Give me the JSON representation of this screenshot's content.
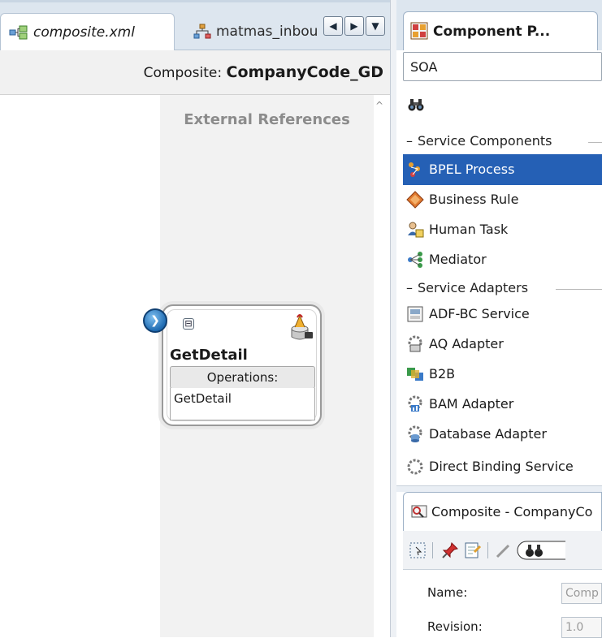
{
  "editor": {
    "tabs": [
      {
        "label": "composite.xml",
        "active": true,
        "icon": "composite-diagram-icon"
      },
      {
        "label": "matmas_inbou",
        "active": false,
        "icon": "mediator-flow-icon"
      }
    ],
    "nav_buttons": [
      "scroll-left-icon",
      "scroll-right-icon",
      "tab-list-dropdown-icon"
    ],
    "composite_label": "Composite:",
    "composite_name": "CompanyCode_GD",
    "swimlane_title": "External References",
    "component": {
      "title": "GetDetail",
      "operations_header": "Operations:",
      "operations": [
        "GetDetail"
      ],
      "collapse_symbol": "⊟",
      "service_icon": "web-service-icon",
      "pin_icon": "interface-pin-icon"
    }
  },
  "palette": {
    "tab_label": "Component P...",
    "category": "SOA",
    "search_icon": "binoculars-icon",
    "sections": [
      {
        "title": "Service Components",
        "items": [
          {
            "label": "BPEL Process",
            "icon": "bpel-process-icon",
            "selected": true
          },
          {
            "label": "Business Rule",
            "icon": "business-rule-icon",
            "selected": false
          },
          {
            "label": "Human Task",
            "icon": "human-task-icon",
            "selected": false
          },
          {
            "label": "Mediator",
            "icon": "mediator-icon",
            "selected": false
          }
        ]
      },
      {
        "title": "Service Adapters",
        "items": [
          {
            "label": "ADF-BC Service",
            "icon": "adf-bc-service-icon",
            "selected": false
          },
          {
            "label": "AQ Adapter",
            "icon": "aq-adapter-icon",
            "selected": false
          },
          {
            "label": "B2B",
            "icon": "b2b-icon",
            "selected": false
          },
          {
            "label": "BAM Adapter",
            "icon": "bam-adapter-icon",
            "selected": false
          },
          {
            "label": "Database Adapter",
            "icon": "database-adapter-icon",
            "selected": false
          },
          {
            "label": "Direct Binding Service",
            "icon": "direct-binding-icon",
            "selected": false
          }
        ]
      }
    ]
  },
  "inspector": {
    "tab_label": "Composite - CompanyCo",
    "toolbar_icons": [
      "select-icon",
      "pin-icon",
      "edit-icon",
      "pencil-icon",
      "binoculars-icon"
    ],
    "properties": [
      {
        "label": "Name:",
        "value": "Comp"
      },
      {
        "label": "Revision:",
        "value": "1.0"
      }
    ]
  },
  "colors": {
    "selection": "#2560b5",
    "tab_strip": "#dde6ef",
    "swimlane": "#f2f2f2"
  }
}
